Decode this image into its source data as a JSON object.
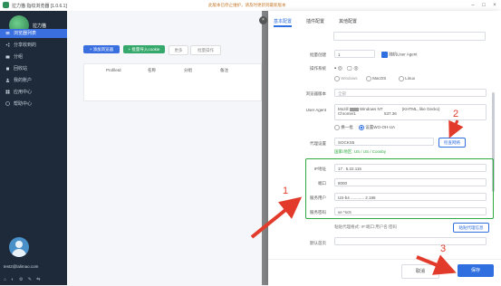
{
  "titlebar": {
    "title": "拉力猫 指纹浏览器 [1.0.6.1]",
    "notice": "此版本已停止维护，请及时更新到最新版本",
    "minimize": "–",
    "maximize": "□",
    "close": "×"
  },
  "sidebar": {
    "brand": "拉力猫",
    "items": [
      {
        "label": "浏览器列表",
        "icon": "list-icon",
        "active": true
      },
      {
        "label": "分享收到的",
        "icon": "share-icon",
        "active": false
      },
      {
        "label": "分组",
        "icon": "folder-icon",
        "active": false
      },
      {
        "label": "回收站",
        "icon": "trash-icon",
        "active": false
      },
      {
        "label": "我的账户",
        "icon": "user-icon",
        "active": false
      },
      {
        "label": "应用中心",
        "icon": "grid-icon",
        "active": false
      },
      {
        "label": "帮助中心",
        "icon": "help-icon",
        "active": false
      }
    ],
    "user_email": "test2@lalimao.com",
    "bottom_icons": "⌂ ◐ ⚙ ✎ ⇆"
  },
  "main": {
    "create_btn": "+ 添加浏览器",
    "batch_btn": "+ 批量导入cookie",
    "toolbar_more": "更多",
    "batch_ops": "批量操作",
    "table_headers": [
      "ProfileId",
      "名称",
      "分组",
      "备注"
    ]
  },
  "drawer": {
    "tabs": [
      "基本配置",
      "插件配置",
      "其他配置"
    ],
    "rows": {
      "batch_count_label": "批量创建",
      "batch_count_value": "1",
      "random_ua_label": "随机User Agent",
      "os_label": "操作系统",
      "os_options": [
        "Windows",
        "MacOS",
        "Linux"
      ],
      "browser_version_label": "浏览器版本",
      "browser_version_value": "全部",
      "ua_label": "User Agent",
      "ua_value_1": "Mozill",
      "ua_value_2": "Chrome/1",
      "ua_value_3": "Windows NT",
      "ua_value_4": "(KHTML, like Gecko)",
      "ua_value_5": "537.36",
      "ua_switch_1": "换一批",
      "ua_switch_2": "设置WO-OH-UA",
      "proxy_label": "代理设置",
      "proxy_value": "SOCKS5",
      "check_proxy_btn": "检查网络",
      "proxy_result": "国家/地区: US / US / Coosby",
      "ip_label": "IP地址",
      "ip_value": "17 . 5.22.115",
      "port_label": "端口",
      "port_value": "8000",
      "proxy_user_label": "服务用户",
      "proxy_user_value": "US-b4 ............ 2.186",
      "proxy_pass_label": "服务密码",
      "proxy_pass_value": "ve        *sc5",
      "paste_hint": "粘贴代理格式: IP:端口:用户名:密码",
      "paste_btn": "粘贴代理信息",
      "homepage_label": "默认首页"
    },
    "cancel": "取消",
    "save": "保存"
  },
  "annotations": {
    "n1": "1",
    "n2": "2",
    "n3": "3"
  },
  "colors": {
    "accent": "#2f6fe0",
    "sidebar": "#1e2a3a",
    "annotation": "#e23b2b",
    "highlight": "#2eaa3f"
  }
}
